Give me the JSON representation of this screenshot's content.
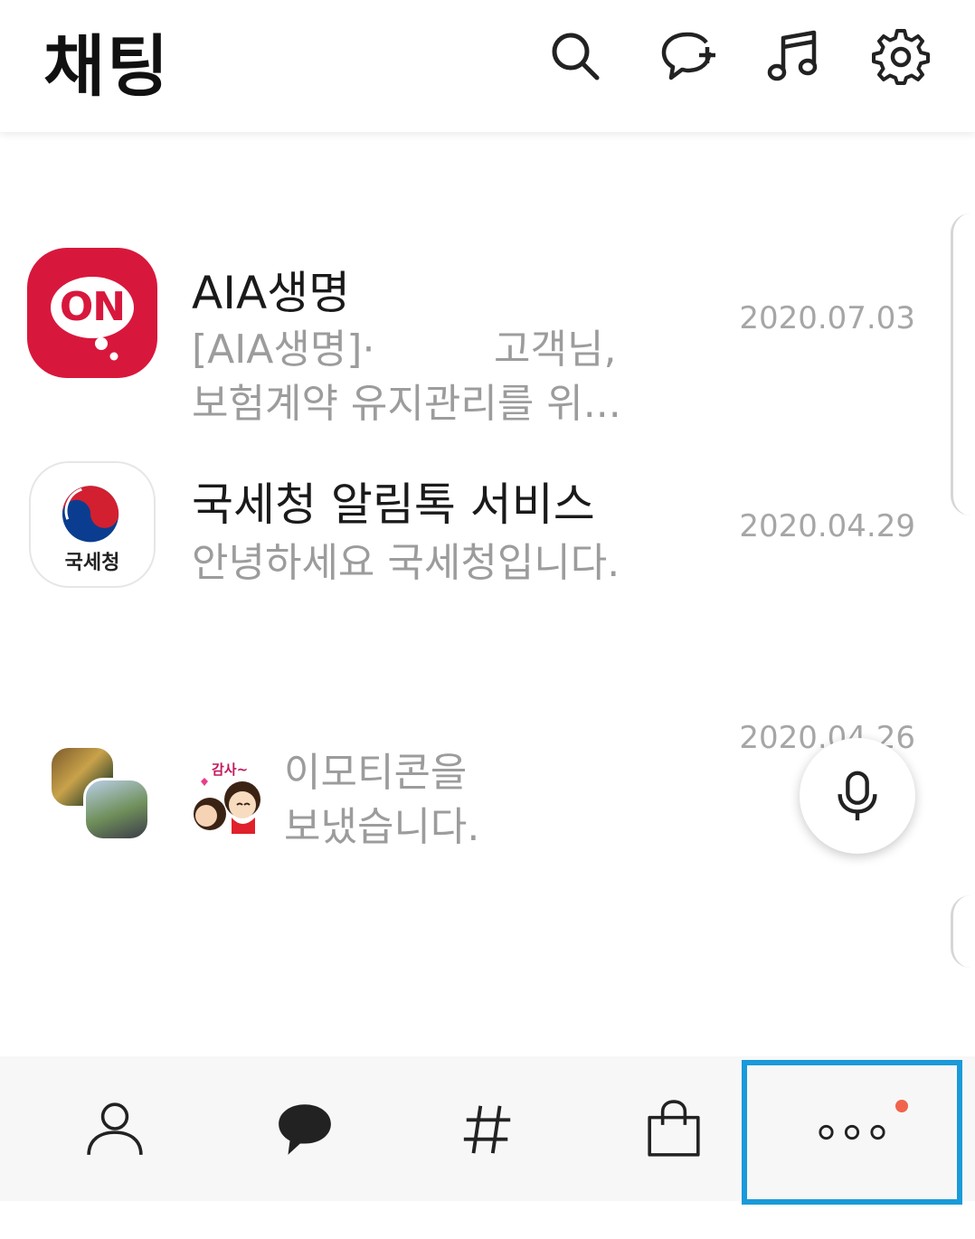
{
  "header": {
    "title": "채팅",
    "icons": [
      "search-icon",
      "new-chat-icon",
      "music-icon",
      "settings-icon"
    ]
  },
  "chats": [
    {
      "name": "AIA생명",
      "preview_line1": "[AIA생명]·",
      "preview_line1_tail": "고객님,",
      "preview_line2": "보험계약 유지관리를 위...",
      "date": "2020.07.03",
      "avatar_text": "ON",
      "avatar_color": "#d8173c"
    },
    {
      "name": "국세청 알림톡 서비스",
      "preview_line1": "안녕하세요 국세청입니다.",
      "date": "2020.04.29",
      "avatar_text": "국세청"
    },
    {
      "name": "",
      "sticker_text": "감사~",
      "preview_line1": "이모티콘을",
      "preview_line2": "보냈습니다.",
      "date": "2020.04.26"
    }
  ],
  "fab": {
    "icon": "microphone-icon"
  },
  "tabbar": {
    "tabs": [
      "friends-tab",
      "chats-tab",
      "openchat-tab",
      "shopping-tab",
      "more-tab"
    ],
    "highlight_color": "#1a9ad9",
    "badge_color": "#f0644b"
  }
}
